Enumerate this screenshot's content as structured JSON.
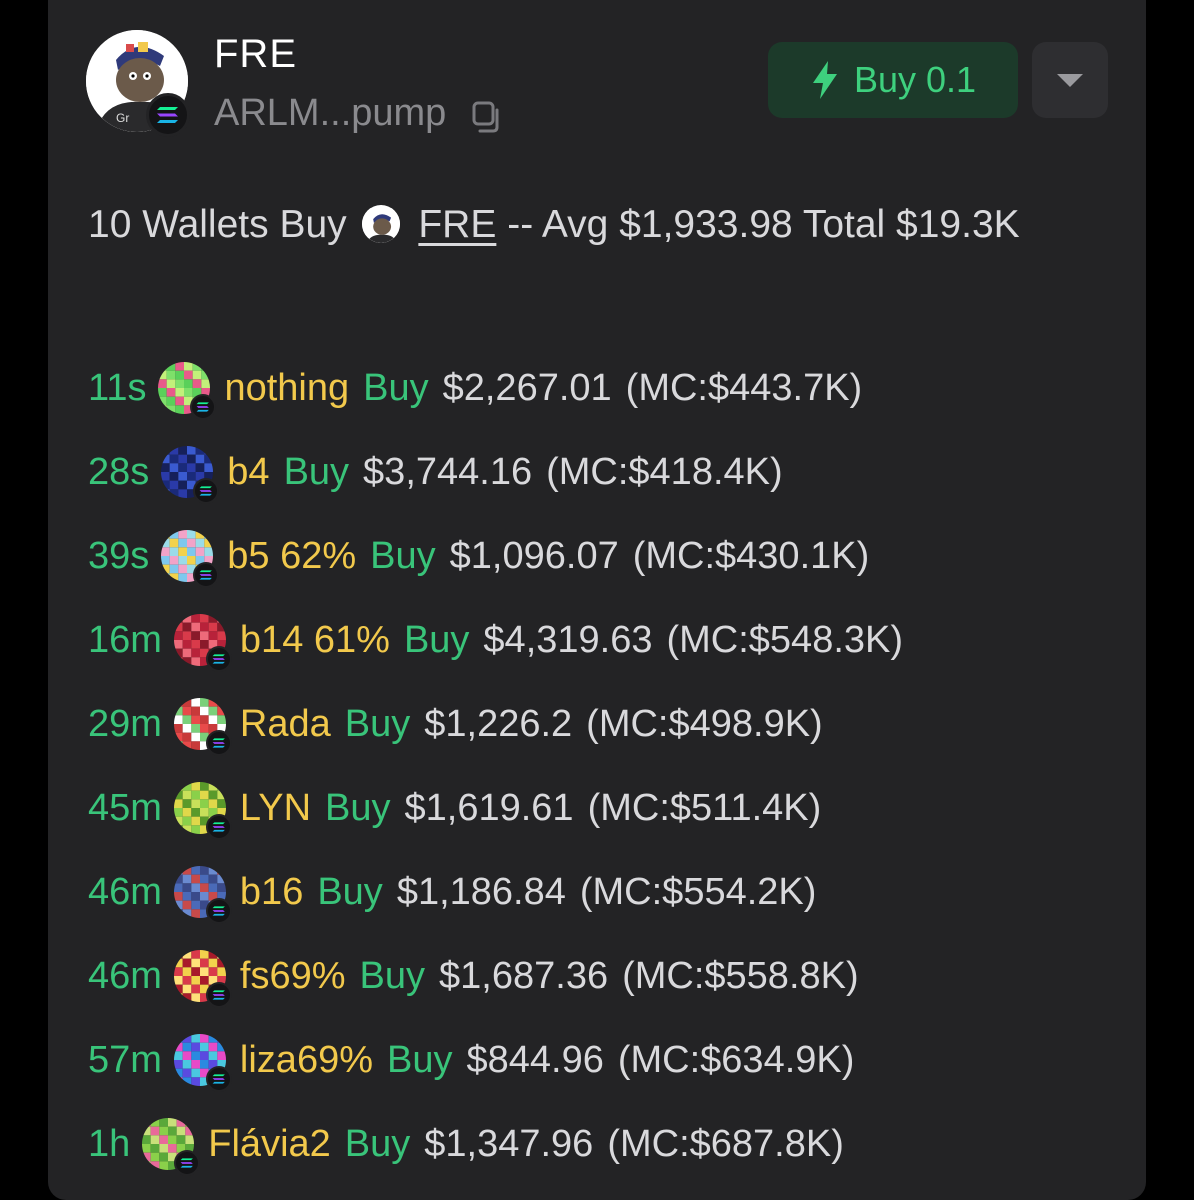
{
  "token": {
    "name": "FRE",
    "address": "ARLM...pump",
    "avatar_icon": "cartoon-character-icon",
    "chain_icon": "solana-icon"
  },
  "actions": {
    "buy_label": "Buy 0.1",
    "buy_icon": "lightning-icon",
    "dropdown_icon": "chevron-down-icon"
  },
  "summary": {
    "prefix": "10 Wallets Buy",
    "token_link": "FRE",
    "suffix": "-- Avg $1,933.98 Total $19.3K"
  },
  "colors": {
    "time": "#39c47a",
    "wallet_name": "#f2c94c",
    "buy": "#39c47a",
    "amount": "#d9d9dc",
    "buy_button_bg": "#1c3a2a"
  },
  "trades": [
    {
      "time": "11s",
      "wallet": "nothing",
      "action": "Buy",
      "amount": "$2,267.01",
      "mc": "(MC:$443.7K)"
    },
    {
      "time": "28s",
      "wallet": "b4",
      "action": "Buy",
      "amount": "$3,744.16",
      "mc": "(MC:$418.4K)"
    },
    {
      "time": "39s",
      "wallet": "b5 62%",
      "action": "Buy",
      "amount": "$1,096.07",
      "mc": "(MC:$430.1K)"
    },
    {
      "time": "16m",
      "wallet": "b14 61%",
      "action": "Buy",
      "amount": "$4,319.63",
      "mc": "(MC:$548.3K)"
    },
    {
      "time": "29m",
      "wallet": "Rada",
      "action": "Buy",
      "amount": "$1,226.2",
      "mc": "(MC:$498.9K)"
    },
    {
      "time": "45m",
      "wallet": "LYN",
      "action": "Buy",
      "amount": "$1,619.61",
      "mc": "(MC:$511.4K)"
    },
    {
      "time": "46m",
      "wallet": "b16",
      "action": "Buy",
      "amount": "$1,186.84",
      "mc": "(MC:$554.2K)"
    },
    {
      "time": "46m",
      "wallet": "fs69%",
      "action": "Buy",
      "amount": "$1,687.36",
      "mc": "(MC:$558.8K)"
    },
    {
      "time": "57m",
      "wallet": "liza69%",
      "action": "Buy",
      "amount": "$844.96",
      "mc": "(MC:$634.9K)"
    },
    {
      "time": "1h",
      "wallet": "Flávia2",
      "action": "Buy",
      "amount": "$1,347.96",
      "mc": "(MC:$687.8K)"
    }
  ]
}
